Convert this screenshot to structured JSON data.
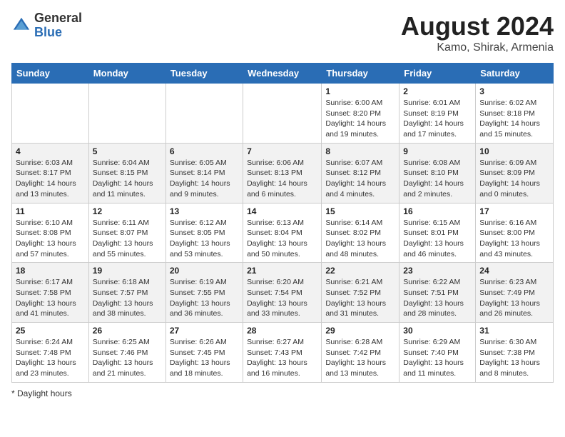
{
  "header": {
    "logo_general": "General",
    "logo_blue": "Blue",
    "title": "August 2024",
    "subtitle": "Kamo, Shirak, Armenia"
  },
  "days_of_week": [
    "Sunday",
    "Monday",
    "Tuesday",
    "Wednesday",
    "Thursday",
    "Friday",
    "Saturday"
  ],
  "weeks": [
    [
      {
        "day": "",
        "info": ""
      },
      {
        "day": "",
        "info": ""
      },
      {
        "day": "",
        "info": ""
      },
      {
        "day": "",
        "info": ""
      },
      {
        "day": "1",
        "info": "Sunrise: 6:00 AM\nSunset: 8:20 PM\nDaylight: 14 hours and 19 minutes."
      },
      {
        "day": "2",
        "info": "Sunrise: 6:01 AM\nSunset: 8:19 PM\nDaylight: 14 hours and 17 minutes."
      },
      {
        "day": "3",
        "info": "Sunrise: 6:02 AM\nSunset: 8:18 PM\nDaylight: 14 hours and 15 minutes."
      }
    ],
    [
      {
        "day": "4",
        "info": "Sunrise: 6:03 AM\nSunset: 8:17 PM\nDaylight: 14 hours and 13 minutes."
      },
      {
        "day": "5",
        "info": "Sunrise: 6:04 AM\nSunset: 8:15 PM\nDaylight: 14 hours and 11 minutes."
      },
      {
        "day": "6",
        "info": "Sunrise: 6:05 AM\nSunset: 8:14 PM\nDaylight: 14 hours and 9 minutes."
      },
      {
        "day": "7",
        "info": "Sunrise: 6:06 AM\nSunset: 8:13 PM\nDaylight: 14 hours and 6 minutes."
      },
      {
        "day": "8",
        "info": "Sunrise: 6:07 AM\nSunset: 8:12 PM\nDaylight: 14 hours and 4 minutes."
      },
      {
        "day": "9",
        "info": "Sunrise: 6:08 AM\nSunset: 8:10 PM\nDaylight: 14 hours and 2 minutes."
      },
      {
        "day": "10",
        "info": "Sunrise: 6:09 AM\nSunset: 8:09 PM\nDaylight: 14 hours and 0 minutes."
      }
    ],
    [
      {
        "day": "11",
        "info": "Sunrise: 6:10 AM\nSunset: 8:08 PM\nDaylight: 13 hours and 57 minutes."
      },
      {
        "day": "12",
        "info": "Sunrise: 6:11 AM\nSunset: 8:07 PM\nDaylight: 13 hours and 55 minutes."
      },
      {
        "day": "13",
        "info": "Sunrise: 6:12 AM\nSunset: 8:05 PM\nDaylight: 13 hours and 53 minutes."
      },
      {
        "day": "14",
        "info": "Sunrise: 6:13 AM\nSunset: 8:04 PM\nDaylight: 13 hours and 50 minutes."
      },
      {
        "day": "15",
        "info": "Sunrise: 6:14 AM\nSunset: 8:02 PM\nDaylight: 13 hours and 48 minutes."
      },
      {
        "day": "16",
        "info": "Sunrise: 6:15 AM\nSunset: 8:01 PM\nDaylight: 13 hours and 46 minutes."
      },
      {
        "day": "17",
        "info": "Sunrise: 6:16 AM\nSunset: 8:00 PM\nDaylight: 13 hours and 43 minutes."
      }
    ],
    [
      {
        "day": "18",
        "info": "Sunrise: 6:17 AM\nSunset: 7:58 PM\nDaylight: 13 hours and 41 minutes."
      },
      {
        "day": "19",
        "info": "Sunrise: 6:18 AM\nSunset: 7:57 PM\nDaylight: 13 hours and 38 minutes."
      },
      {
        "day": "20",
        "info": "Sunrise: 6:19 AM\nSunset: 7:55 PM\nDaylight: 13 hours and 36 minutes."
      },
      {
        "day": "21",
        "info": "Sunrise: 6:20 AM\nSunset: 7:54 PM\nDaylight: 13 hours and 33 minutes."
      },
      {
        "day": "22",
        "info": "Sunrise: 6:21 AM\nSunset: 7:52 PM\nDaylight: 13 hours and 31 minutes."
      },
      {
        "day": "23",
        "info": "Sunrise: 6:22 AM\nSunset: 7:51 PM\nDaylight: 13 hours and 28 minutes."
      },
      {
        "day": "24",
        "info": "Sunrise: 6:23 AM\nSunset: 7:49 PM\nDaylight: 13 hours and 26 minutes."
      }
    ],
    [
      {
        "day": "25",
        "info": "Sunrise: 6:24 AM\nSunset: 7:48 PM\nDaylight: 13 hours and 23 minutes."
      },
      {
        "day": "26",
        "info": "Sunrise: 6:25 AM\nSunset: 7:46 PM\nDaylight: 13 hours and 21 minutes."
      },
      {
        "day": "27",
        "info": "Sunrise: 6:26 AM\nSunset: 7:45 PM\nDaylight: 13 hours and 18 minutes."
      },
      {
        "day": "28",
        "info": "Sunrise: 6:27 AM\nSunset: 7:43 PM\nDaylight: 13 hours and 16 minutes."
      },
      {
        "day": "29",
        "info": "Sunrise: 6:28 AM\nSunset: 7:42 PM\nDaylight: 13 hours and 13 minutes."
      },
      {
        "day": "30",
        "info": "Sunrise: 6:29 AM\nSunset: 7:40 PM\nDaylight: 13 hours and 11 minutes."
      },
      {
        "day": "31",
        "info": "Sunrise: 6:30 AM\nSunset: 7:38 PM\nDaylight: 13 hours and 8 minutes."
      }
    ]
  ],
  "footer": {
    "note": "Daylight hours"
  }
}
